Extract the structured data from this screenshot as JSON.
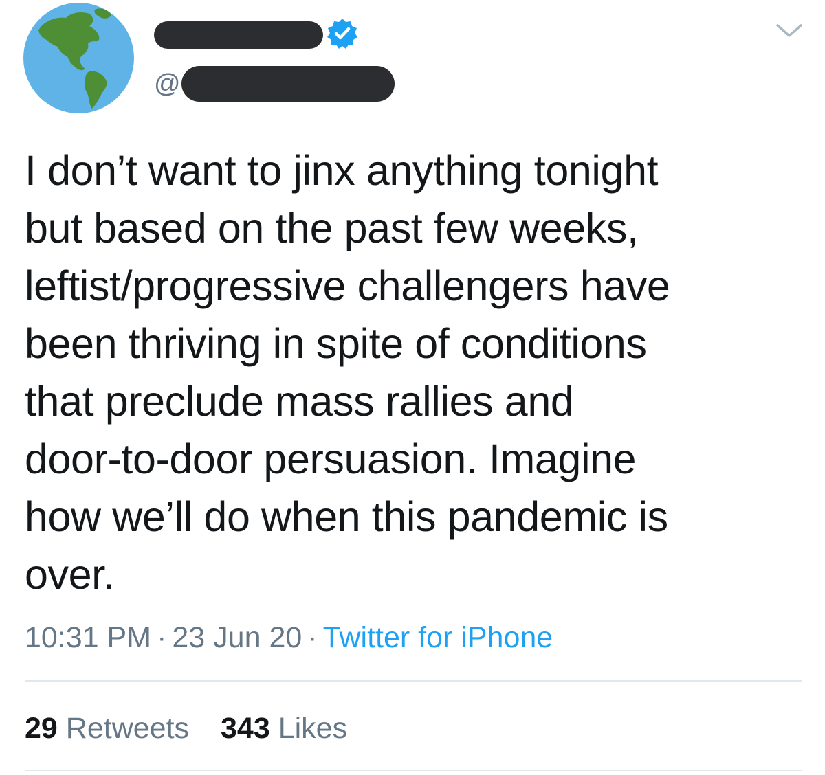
{
  "tweet": {
    "handle_prefix": "@",
    "text": "I don’t want to jinx anything tonight\nbut based on the past few weeks,\nleftist/progressive challengers have\nbeen thriving in spite of conditions\nthat preclude mass rallies and\ndoor-to-door persuasion. Imagine\nhow we’ll do when this pandemic is\nover.",
    "time": "10:31 PM",
    "date": "23 Jun 20",
    "separator": "·",
    "source": "Twitter for iPhone"
  },
  "stats": {
    "retweets_count": "29",
    "retweets_label": "Retweets",
    "likes_count": "343",
    "likes_label": "Likes"
  },
  "icons": {
    "avatar": "globe-americas-icon",
    "verified": "verified-badge-icon",
    "menu": "chevron-down-icon"
  },
  "colors": {
    "text": "#14171a",
    "secondary": "#657786",
    "link": "#1da1f2",
    "verified": "#1da1f2",
    "redaction": "#2b2d31"
  }
}
